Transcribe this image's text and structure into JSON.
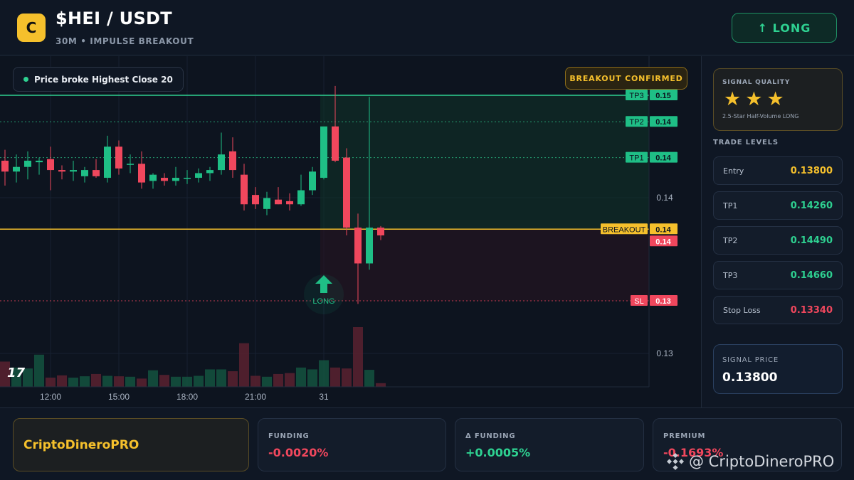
{
  "header": {
    "logo_letter": "C",
    "pair": "$HEI / USDT",
    "subtitle": "30M • IMPULSE BREAKOUT",
    "long_button": "↑ LONG"
  },
  "chart": {
    "note": "Price broke Highest Close 20",
    "badge": "BREAKOUT CONFIRMED",
    "long_marker": "LONG",
    "tv_logo": "17",
    "time_labels": [
      "12:00",
      "15:00",
      "18:00",
      "21:00",
      "31"
    ],
    "price_axis": [
      "0.14",
      "0.13"
    ],
    "level_tags": [
      {
        "name": "TP3",
        "value": "0.15"
      },
      {
        "name": "TP2",
        "value": "0.14"
      },
      {
        "name": "TP1",
        "value": "0.14"
      },
      {
        "name": "BREAKOUT",
        "value": "0.14"
      },
      {
        "name": "",
        "value": "0.14"
      },
      {
        "name": "SL",
        "value": "0.13"
      }
    ]
  },
  "chart_data": {
    "type": "candlestick",
    "x": [
      "12:00",
      "15:00",
      "18:00",
      "21:00",
      "31"
    ],
    "levels": {
      "TP3": 0.1466,
      "TP2": 0.1449,
      "TP1": 0.1426,
      "Entry": 0.138,
      "SL": 0.1334
    },
    "candles": [
      {
        "o": 0.1424,
        "h": 0.1431,
        "l": 0.1408,
        "c": 0.1417
      },
      {
        "o": 0.1417,
        "h": 0.1428,
        "l": 0.141,
        "c": 0.142
      },
      {
        "o": 0.142,
        "h": 0.143,
        "l": 0.1412,
        "c": 0.1424
      },
      {
        "o": 0.1423,
        "h": 0.1426,
        "l": 0.1415,
        "c": 0.1424
      },
      {
        "o": 0.1425,
        "h": 0.1433,
        "l": 0.1405,
        "c": 0.1418
      },
      {
        "o": 0.1418,
        "h": 0.1421,
        "l": 0.1412,
        "c": 0.1417
      },
      {
        "o": 0.1417,
        "h": 0.1424,
        "l": 0.1411,
        "c": 0.1418
      },
      {
        "o": 0.1414,
        "h": 0.142,
        "l": 0.141,
        "c": 0.1418
      },
      {
        "o": 0.1418,
        "h": 0.1425,
        "l": 0.1413,
        "c": 0.1414
      },
      {
        "o": 0.1413,
        "h": 0.144,
        "l": 0.141,
        "c": 0.1433
      },
      {
        "o": 0.1433,
        "h": 0.1437,
        "l": 0.1415,
        "c": 0.1419
      },
      {
        "o": 0.1422,
        "h": 0.1428,
        "l": 0.1416,
        "c": 0.1422
      },
      {
        "o": 0.1422,
        "h": 0.143,
        "l": 0.1406,
        "c": 0.141
      },
      {
        "o": 0.1411,
        "h": 0.1416,
        "l": 0.1406,
        "c": 0.1415
      },
      {
        "o": 0.1413,
        "h": 0.1416,
        "l": 0.1408,
        "c": 0.1411
      },
      {
        "o": 0.1411,
        "h": 0.142,
        "l": 0.1408,
        "c": 0.1413
      },
      {
        "o": 0.1413,
        "h": 0.1418,
        "l": 0.1409,
        "c": 0.1413
      },
      {
        "o": 0.1413,
        "h": 0.1419,
        "l": 0.141,
        "c": 0.1416
      },
      {
        "o": 0.1416,
        "h": 0.142,
        "l": 0.1411,
        "c": 0.1418
      },
      {
        "o": 0.1418,
        "h": 0.1442,
        "l": 0.1415,
        "c": 0.1428
      },
      {
        "o": 0.143,
        "h": 0.1439,
        "l": 0.1413,
        "c": 0.1418
      },
      {
        "o": 0.1415,
        "h": 0.1422,
        "l": 0.1392,
        "c": 0.1396
      },
      {
        "o": 0.1402,
        "h": 0.1407,
        "l": 0.1393,
        "c": 0.1396
      },
      {
        "o": 0.1393,
        "h": 0.1404,
        "l": 0.1389,
        "c": 0.14
      },
      {
        "o": 0.1399,
        "h": 0.1407,
        "l": 0.1396,
        "c": 0.1396
      },
      {
        "o": 0.1398,
        "h": 0.1403,
        "l": 0.1392,
        "c": 0.1396
      },
      {
        "o": 0.1396,
        "h": 0.1415,
        "l": 0.1395,
        "c": 0.1405
      },
      {
        "o": 0.1405,
        "h": 0.142,
        "l": 0.1402,
        "c": 0.1417
      },
      {
        "o": 0.1413,
        "h": 0.1445,
        "l": 0.1412,
        "c": 0.1446
      },
      {
        "o": 0.1446,
        "h": 0.1472,
        "l": 0.1423,
        "c": 0.1424
      },
      {
        "o": 0.1426,
        "h": 0.1432,
        "l": 0.1376,
        "c": 0.1381
      },
      {
        "o": 0.1381,
        "h": 0.139,
        "l": 0.1332,
        "c": 0.1358
      },
      {
        "o": 0.1358,
        "h": 0.1465,
        "l": 0.1354,
        "c": 0.1381
      },
      {
        "o": 0.1381,
        "h": 0.1382,
        "l": 0.1373,
        "c": 0.1376
      }
    ],
    "volume": [
      55,
      42,
      40,
      70,
      20,
      25,
      20,
      23,
      28,
      24,
      23,
      22,
      18,
      36,
      26,
      22,
      22,
      24,
      38,
      38,
      34,
      95,
      24,
      22,
      28,
      30,
      42,
      38,
      58,
      42,
      40,
      130,
      37,
      8
    ]
  },
  "panel": {
    "quality_title": "SIGNAL QUALITY",
    "stars": "★★★",
    "quality_desc": "2.5-Star Half-Volume LONG",
    "trade_levels_title": "TRADE LEVELS",
    "levels": [
      {
        "label": "Entry",
        "value": "0.13800",
        "color": "#f5c02c"
      },
      {
        "label": "TP1",
        "value": "0.14260",
        "color": "#2ed191"
      },
      {
        "label": "TP2",
        "value": "0.14490",
        "color": "#2ed191"
      },
      {
        "label": "TP3",
        "value": "0.14660",
        "color": "#2ed191"
      },
      {
        "label": "Stop Loss",
        "value": "0.13340",
        "color": "#f0475d"
      }
    ],
    "signal_price_label": "SIGNAL PRICE",
    "signal_price": "0.13800"
  },
  "footer": {
    "brand": "CriptoDineroPRO",
    "cards": [
      {
        "label": "FUNDING",
        "value": "-0.0020%",
        "color": "#f0475d"
      },
      {
        "label": "Δ FUNDING",
        "value": "+0.0005%",
        "color": "#2ed191"
      },
      {
        "label": "PREMIUM",
        "value": "-0.1693%",
        "color": "#f0475d"
      }
    ],
    "watermark": "@ CriptoDineroPRO"
  },
  "colors": {
    "bull": "#1fbf86",
    "bear": "#f0475d",
    "accent": "#f5c02c"
  }
}
